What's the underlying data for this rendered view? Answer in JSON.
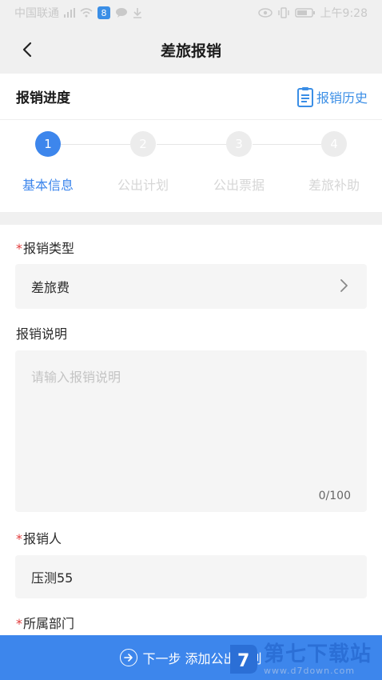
{
  "status_bar": {
    "carrier": "中国联通",
    "app_badge": "8",
    "time": "上午9:28"
  },
  "navbar": {
    "title": "差旅报销"
  },
  "progress": {
    "title": "报销进度",
    "history_label": "报销历史"
  },
  "steps": [
    {
      "number": "1",
      "label": "基本信息",
      "active": true
    },
    {
      "number": "2",
      "label": "公出计划",
      "active": false
    },
    {
      "number": "3",
      "label": "公出票据",
      "active": false
    },
    {
      "number": "4",
      "label": "差旅补助",
      "active": false
    }
  ],
  "form": {
    "required_mark": "*",
    "type_label": "报销类型",
    "type_value": "差旅费",
    "desc_label": "报销说明",
    "desc_placeholder": "请输入报销说明",
    "desc_counter": "0/100",
    "person_label": "报销人",
    "person_value": "压测55",
    "dept_label": "所属部门"
  },
  "bottom": {
    "next_label": "下一步 添加公出计划"
  },
  "watermark": {
    "main": "第七下载站",
    "sub": "www.d7down.com"
  },
  "colors": {
    "accent": "#3d86ec",
    "required": "#e23b3b",
    "background_gray": "#f0f0f0"
  }
}
